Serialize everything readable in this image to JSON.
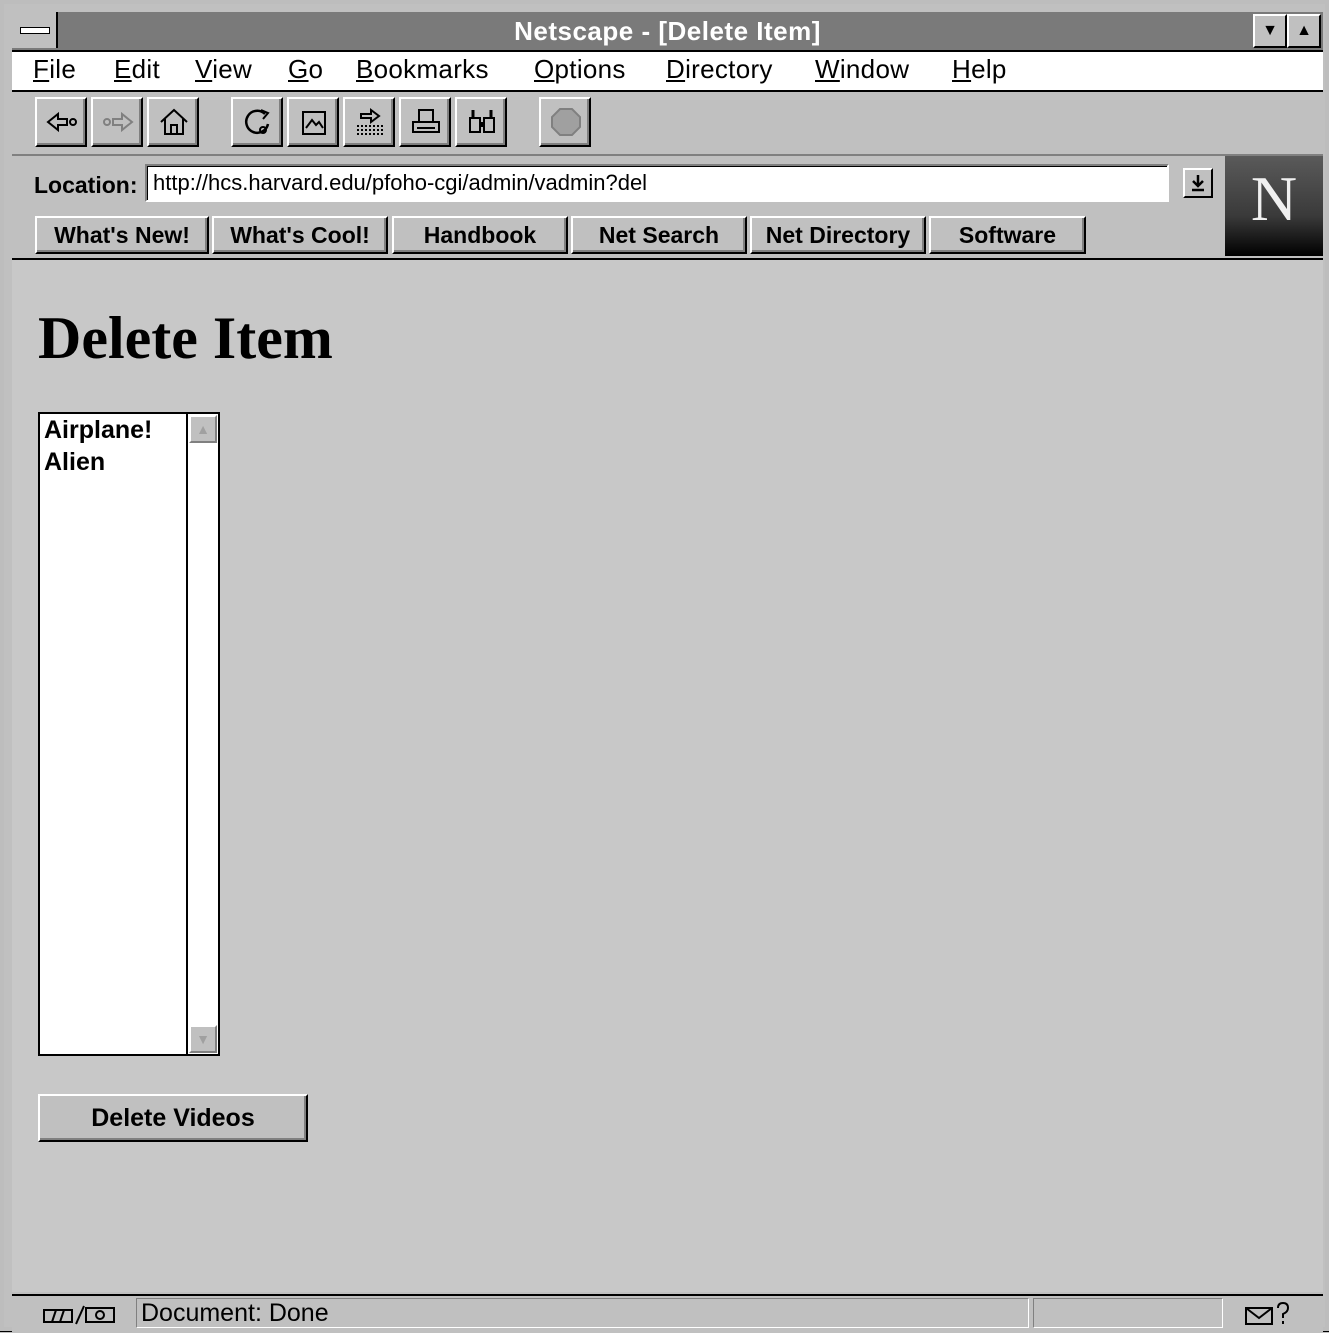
{
  "window": {
    "title": "Netscape - [Delete Item]"
  },
  "menu": {
    "items": [
      {
        "first": "F",
        "rest": "ile"
      },
      {
        "first": "E",
        "rest": "dit"
      },
      {
        "first": "V",
        "rest": "iew"
      },
      {
        "first": "G",
        "rest": "o"
      },
      {
        "first": "B",
        "rest": "ookmarks"
      },
      {
        "first": "O",
        "rest": "ptions"
      },
      {
        "first": "D",
        "rest": "irectory"
      },
      {
        "first": "W",
        "rest": "indow"
      },
      {
        "first": "H",
        "rest": "elp"
      }
    ]
  },
  "toolbar": {
    "icons": [
      "back-icon",
      "forward-icon",
      "home-icon",
      "reload-icon",
      "images-icon",
      "open-icon",
      "print-icon",
      "find-icon",
      "stop-icon"
    ]
  },
  "location": {
    "label": "Location:",
    "url": "http://hcs.harvard.edu/pfoho-cgi/admin/vadmin?del"
  },
  "directory_buttons": [
    "What's New!",
    "What's Cool!",
    "Handbook",
    "Net Search",
    "Net Directory",
    "Software"
  ],
  "page": {
    "heading": "Delete Item",
    "list_items": [
      "Airplane!",
      "Alien"
    ],
    "submit_label": "Delete Videos"
  },
  "status": {
    "text": "Document: Done"
  },
  "colors": {
    "chrome": "#c0c0c0",
    "page_bg": "#c8c8c8",
    "titlebar": "#7a7a7a"
  }
}
